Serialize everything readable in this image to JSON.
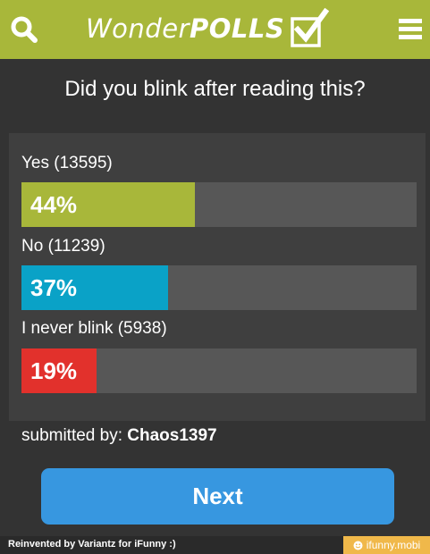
{
  "header": {
    "logo_word": "Wonder",
    "logo_brand": "POLLS",
    "icons": {
      "search": "search-icon",
      "logo_check": "checkmark-box-icon",
      "menu": "hamburger-menu-icon"
    }
  },
  "poll": {
    "question": "Did you blink after reading this?",
    "options": [
      {
        "label": "Yes (13595)",
        "percent_label": "44%",
        "percent": 44,
        "color": "#a8b73a"
      },
      {
        "label": "No (11239)",
        "percent_label": "37%",
        "percent": 37,
        "color": "#0aa2c7"
      },
      {
        "label": "I never blink (5938)",
        "percent_label": "19%",
        "percent": 19,
        "color": "#e2312c"
      }
    ],
    "submitted_prefix": "submitted by:",
    "submitted_user": "Chaos1397",
    "next_label": "Next"
  },
  "footer": {
    "credit": "Reinvented by Variantz for iFunny :)",
    "badge": "ifunny.mobi"
  },
  "colors": {
    "header_bg": "#a8b73a",
    "page_bg": "#333333",
    "panel_bg": "#3f3f3f",
    "bar_track": "#575757",
    "next_button": "#3797e0",
    "badge_bg": "#f0b84a"
  }
}
